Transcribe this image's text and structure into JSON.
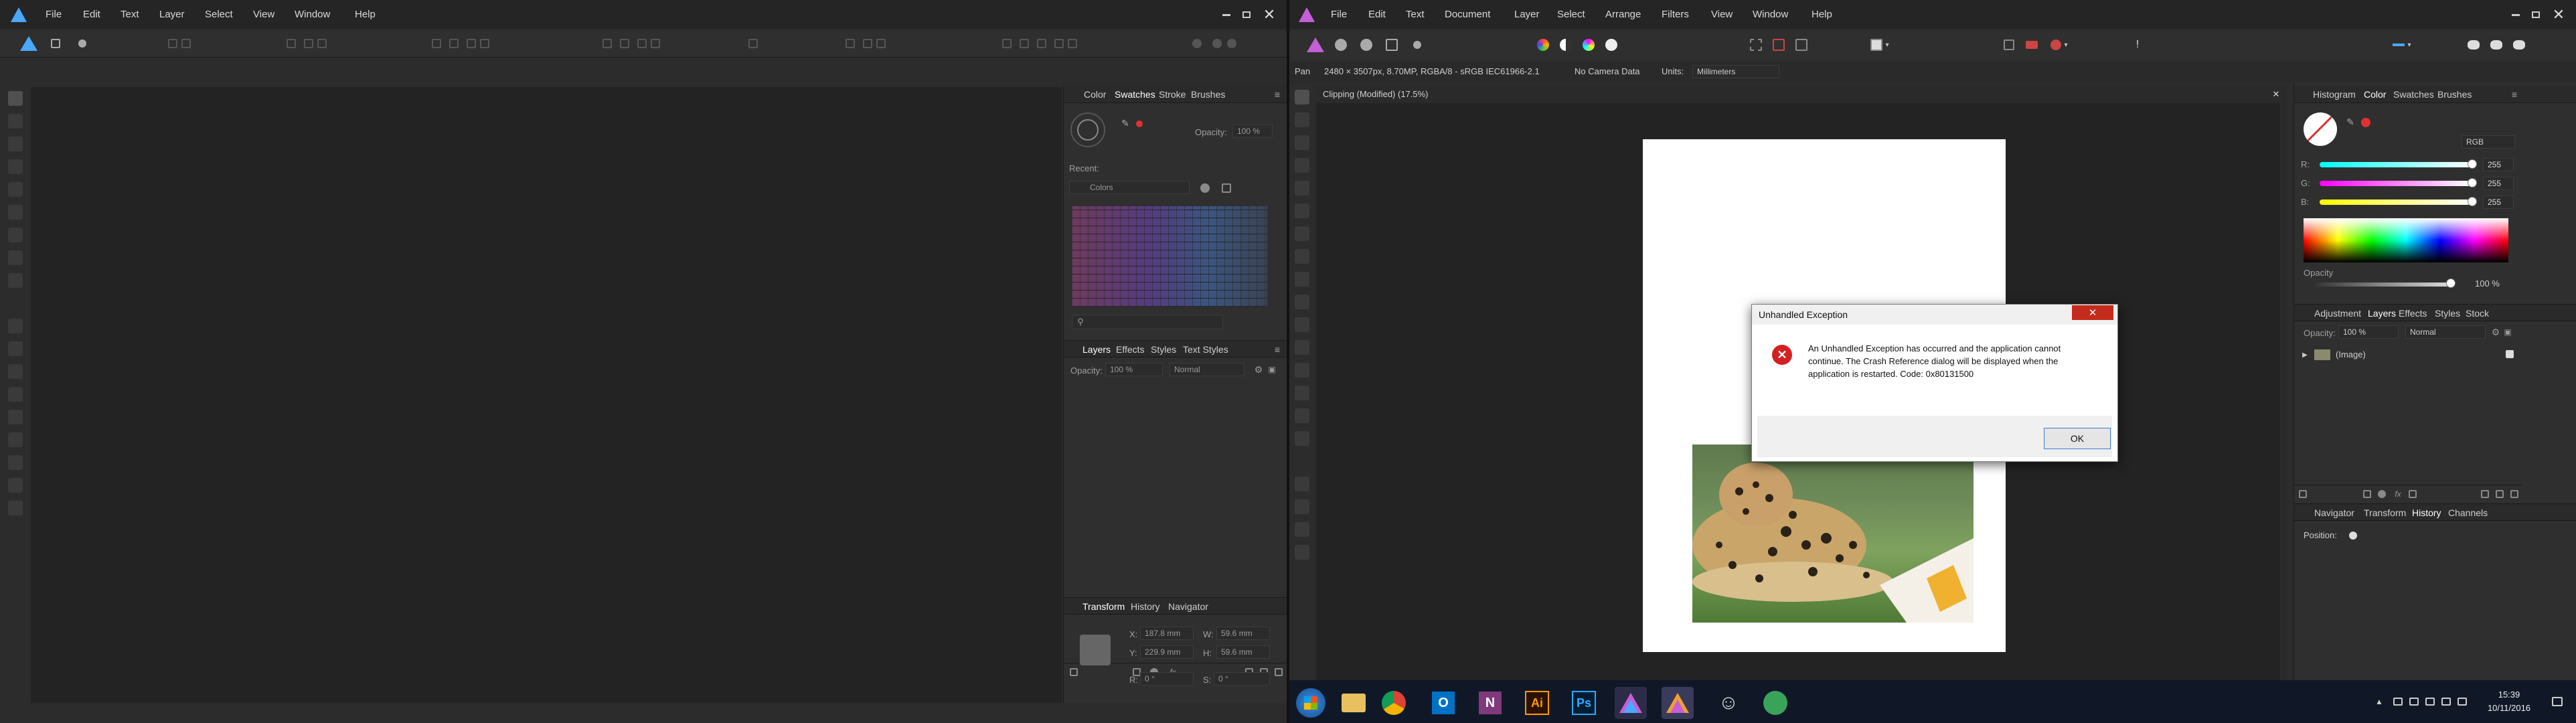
{
  "left_app": {
    "menu": [
      "File",
      "Edit",
      "Text",
      "Layer",
      "Select",
      "View",
      "Window",
      "Help"
    ],
    "color_panel": {
      "tabs": [
        "Color",
        "Swatches",
        "Stroke",
        "Brushes"
      ],
      "opacity_label": "Opacity:",
      "opacity_value": "100 %",
      "recent_label": "Recent:",
      "palette_name": "Colors"
    },
    "layers_panel": {
      "tabs": [
        "Layers",
        "Effects",
        "Styles",
        "Text Styles"
      ],
      "opacity_label": "Opacity:",
      "opacity_value": "100 %",
      "blend_mode": "Normal"
    },
    "transform_panel": {
      "tabs": [
        "Transform",
        "History",
        "Navigator"
      ],
      "x_label": "X:",
      "x_value": "187.8 mm",
      "y_label": "Y:",
      "y_value": "229.9 mm",
      "w_label": "W:",
      "w_value": "59.6 mm",
      "h_label": "H:",
      "h_value": "59.6 mm",
      "r_label": "R:",
      "r_value": "0 °",
      "s_label": "S:",
      "s_value": "0 °"
    }
  },
  "right_app": {
    "menu": [
      "File",
      "Edit",
      "Text",
      "Document",
      "Layer",
      "Select",
      "Arrange",
      "Filters",
      "View",
      "Window",
      "Help"
    ],
    "context_bar": {
      "tool": "Pan",
      "doc_info": "2480 × 3507px, 8.70MP, RGBA/8 - sRGB IEC61966-2.1",
      "camera": "No Camera Data",
      "units_label": "Units:",
      "units_value": "Millimeters"
    },
    "document_tab": "Clipping (Modified) (17.5%)",
    "color_panel": {
      "tabs": [
        "Histogram",
        "Color",
        "Swatches",
        "Brushes"
      ],
      "mode": "RGB",
      "r_label": "R:",
      "r_value": "255",
      "g_label": "G:",
      "g_value": "255",
      "b_label": "B:",
      "b_value": "255",
      "r_fraction": 1.0,
      "g_fraction": 1.0,
      "b_fraction": 1.0,
      "opacity_label": "Opacity",
      "opacity_value": "100 %",
      "opacity_fraction": 1.0
    },
    "layers_panel": {
      "tabs": [
        "Adjustment",
        "Layers",
        "Effects",
        "Styles",
        "Stock"
      ],
      "opacity_label": "Opacity:",
      "opacity_value": "100 %",
      "blend_mode": "Normal",
      "layer_name": "(Image)"
    },
    "history_panel": {
      "tabs": [
        "Navigator",
        "Transform",
        "History",
        "Channels"
      ],
      "position_label": "Position:"
    }
  },
  "dialog": {
    "title": "Unhandled Exception",
    "message": "An Unhandled Exception has occurred and the application cannot continue. The Crash Reference dialog will be displayed when the application is restarted. Code: 0x80131500",
    "ok_label": "OK"
  },
  "taskbar": {
    "time": "15:39",
    "date": "10/11/2016"
  },
  "colors": {
    "accent_red": "#e03030",
    "dialog_title_bg": "#f0f0f0",
    "close_red": "#c42b1c",
    "taskbar_bg": "#101828"
  },
  "icons": [
    "affinity-designer-logo",
    "affinity-photo-logo",
    "windows-start-icon",
    "file-explorer-icon",
    "chrome-icon",
    "outlook-icon",
    "onenote-icon",
    "illustrator-icon",
    "photoshop-icon",
    "affinity-photo-taskbar-icon",
    "affinity-designer-taskbar-icon",
    "emoji-icon",
    "green-app-icon",
    "error-icon"
  ]
}
